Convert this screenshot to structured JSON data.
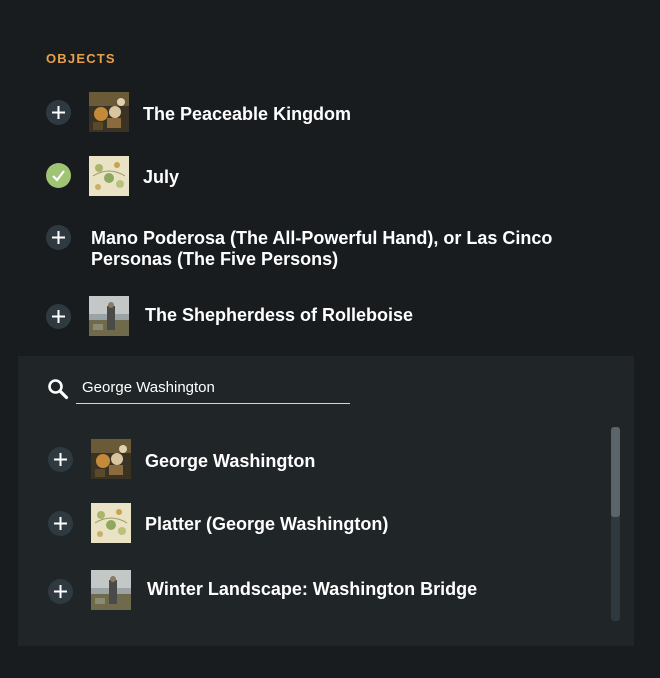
{
  "section": {
    "label": "OBJECTS"
  },
  "objects": [
    {
      "title": "The Peaceable Kingdom",
      "state": "add",
      "thumbnail": "painting-animals"
    },
    {
      "title": "July",
      "state": "added",
      "thumbnail": "painting-pale"
    },
    {
      "title_line1": "Mano Poderosa (The All-Powerful Hand), or Las Cinco",
      "title_line2": "Personas (The Five Persons)",
      "state": "add"
    },
    {
      "title": "The Shepherdess of Rolleboise",
      "state": "add",
      "thumbnail": "painting-landscape"
    }
  ],
  "search": {
    "value": "George Washington",
    "placeholder": "",
    "icon": "search-icon"
  },
  "results": [
    {
      "title": "George Washington",
      "thumbnail": "painting-animals"
    },
    {
      "title": "Platter (George Washington)",
      "thumbnail": "painting-pale"
    },
    {
      "title": "Winter Landscape: Washington Bridge",
      "thumbnail": "painting-landscape"
    }
  ],
  "colors": {
    "background": "#181c1f",
    "panel": "#202628",
    "accent": "#e8a04a",
    "check": "#9fc474",
    "button": "#2f3a40"
  }
}
